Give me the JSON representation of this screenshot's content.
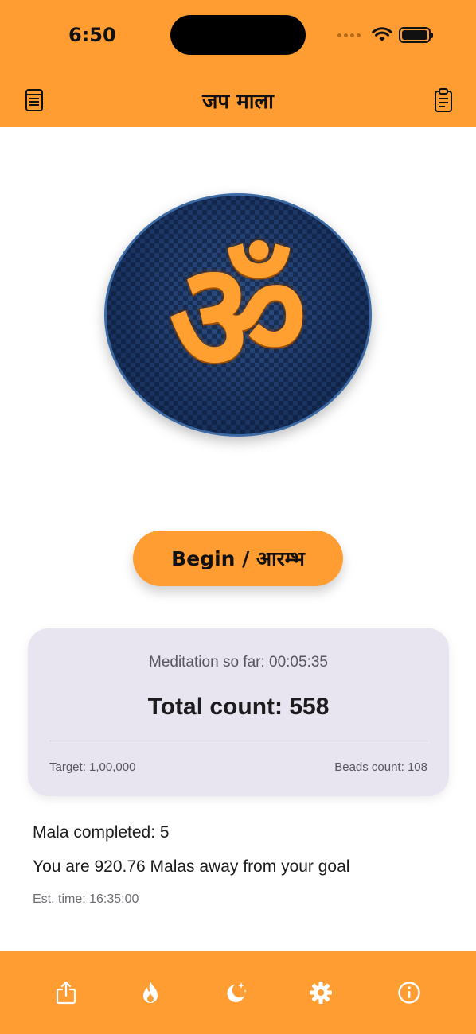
{
  "status_bar": {
    "time": "6:50"
  },
  "nav": {
    "title": "जप माला",
    "left_icon": "notebook-icon",
    "right_icon": "clipboard-icon"
  },
  "hero": {
    "symbol": "ॐ",
    "icon": "om-icon"
  },
  "begin_button": {
    "label": "Begin / आरम्भ"
  },
  "stats_card": {
    "meditation": "Meditation so far: 00:05:35",
    "total": "Total count: 558",
    "target": "Target: 1,00,000",
    "beads": "Beads count: 108"
  },
  "progress": {
    "mala_completed": "Mala completed: 5",
    "goal": "You are 920.76 Malas away from your goal",
    "est_time": "Est. time: 16:35:00"
  },
  "tabs": [
    {
      "icon": "share-icon"
    },
    {
      "icon": "flame-icon"
    },
    {
      "icon": "moon-stars-icon"
    },
    {
      "icon": "gear-icon"
    },
    {
      "icon": "info-icon"
    }
  ],
  "colors": {
    "accent": "#FF9D33",
    "card_bg": "#E8E4F0",
    "disc": "#1f3b6a"
  }
}
